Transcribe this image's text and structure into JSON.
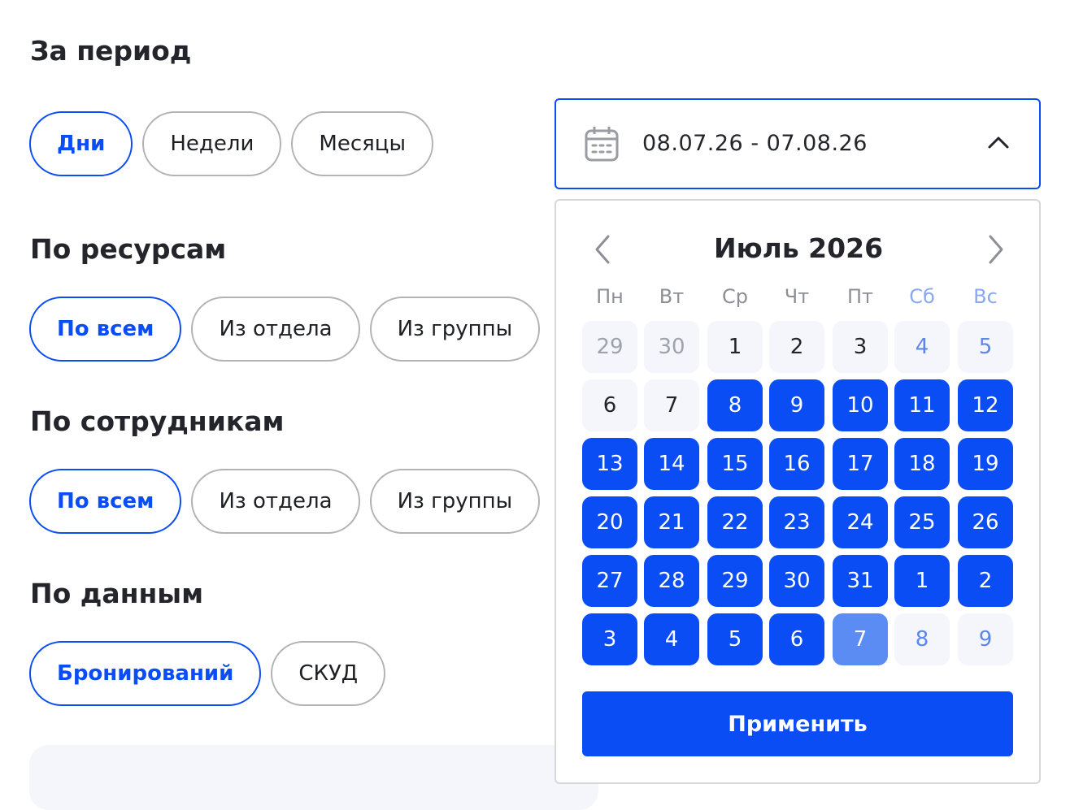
{
  "period": {
    "heading": "За период",
    "options": [
      {
        "label": "Дни",
        "active": true
      },
      {
        "label": "Недели",
        "active": false
      },
      {
        "label": "Месяцы",
        "active": false
      }
    ]
  },
  "resources": {
    "heading": "По ресурсам",
    "options": [
      {
        "label": "По всем",
        "active": true
      },
      {
        "label": "Из отдела",
        "active": false
      },
      {
        "label": "Из группы",
        "active": false
      }
    ]
  },
  "employees": {
    "heading": "По сотрудникам",
    "options": [
      {
        "label": "По всем",
        "active": true
      },
      {
        "label": "Из отдела",
        "active": false
      },
      {
        "label": "Из группы",
        "active": false
      }
    ]
  },
  "data_source": {
    "heading": "По данным",
    "options": [
      {
        "label": "Бронирований",
        "active": true
      },
      {
        "label": "СКУД",
        "active": false
      }
    ]
  },
  "date_range": {
    "value": "08.07.26 - 07.08.26",
    "icon": "calendar-icon",
    "toggle_icon": "chevron-up-icon"
  },
  "calendar": {
    "month_title": "Июль 2026",
    "prev_icon": "chevron-left-icon",
    "next_icon": "chevron-right-icon",
    "weekdays": [
      {
        "label": "Пн",
        "weekend": false
      },
      {
        "label": "Вт",
        "weekend": false
      },
      {
        "label": "Ср",
        "weekend": false
      },
      {
        "label": "Чт",
        "weekend": false
      },
      {
        "label": "Пт",
        "weekend": false
      },
      {
        "label": "Сб",
        "weekend": true
      },
      {
        "label": "Вс",
        "weekend": true
      }
    ],
    "weeks": [
      [
        {
          "day": "29",
          "state": "other"
        },
        {
          "day": "30",
          "state": "other"
        },
        {
          "day": "1",
          "state": "plain"
        },
        {
          "day": "2",
          "state": "plain"
        },
        {
          "day": "3",
          "state": "plain"
        },
        {
          "day": "4",
          "state": "weekend"
        },
        {
          "day": "5",
          "state": "weekend"
        }
      ],
      [
        {
          "day": "6",
          "state": "plain"
        },
        {
          "day": "7",
          "state": "plain"
        },
        {
          "day": "8",
          "state": "selected"
        },
        {
          "day": "9",
          "state": "selected"
        },
        {
          "day": "10",
          "state": "selected"
        },
        {
          "day": "11",
          "state": "selected"
        },
        {
          "day": "12",
          "state": "selected"
        }
      ],
      [
        {
          "day": "13",
          "state": "selected"
        },
        {
          "day": "14",
          "state": "selected"
        },
        {
          "day": "15",
          "state": "selected"
        },
        {
          "day": "16",
          "state": "selected"
        },
        {
          "day": "17",
          "state": "selected"
        },
        {
          "day": "18",
          "state": "selected"
        },
        {
          "day": "19",
          "state": "selected"
        }
      ],
      [
        {
          "day": "20",
          "state": "selected"
        },
        {
          "day": "21",
          "state": "selected"
        },
        {
          "day": "22",
          "state": "selected"
        },
        {
          "day": "23",
          "state": "selected"
        },
        {
          "day": "24",
          "state": "selected"
        },
        {
          "day": "25",
          "state": "selected"
        },
        {
          "day": "26",
          "state": "selected"
        }
      ],
      [
        {
          "day": "27",
          "state": "selected"
        },
        {
          "day": "28",
          "state": "selected"
        },
        {
          "day": "29",
          "state": "selected"
        },
        {
          "day": "30",
          "state": "selected"
        },
        {
          "day": "31",
          "state": "selected"
        },
        {
          "day": "1",
          "state": "selected"
        },
        {
          "day": "2",
          "state": "selected"
        }
      ],
      [
        {
          "day": "3",
          "state": "selected"
        },
        {
          "day": "4",
          "state": "selected"
        },
        {
          "day": "5",
          "state": "selected"
        },
        {
          "day": "6",
          "state": "selected"
        },
        {
          "day": "7",
          "state": "range-end"
        },
        {
          "day": "8",
          "state": "weekend"
        },
        {
          "day": "9",
          "state": "weekend"
        }
      ]
    ],
    "apply_label": "Применить"
  },
  "colors": {
    "accent": "#0a4df5",
    "range_end": "#5b8cf4",
    "text": "#23252b",
    "chip_border": "#b3b3b3",
    "cell_bg": "#f4f6fb"
  }
}
